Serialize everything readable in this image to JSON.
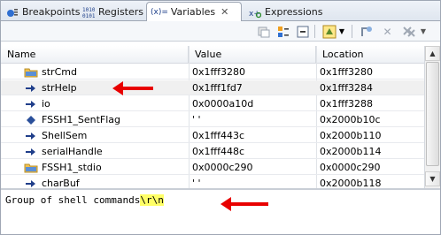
{
  "tabs": [
    {
      "label": "Breakpoints",
      "icon": "breakpoints-icon"
    },
    {
      "label": "Registers",
      "icon": "registers-icon"
    },
    {
      "label": "Variables",
      "icon": "variables-icon",
      "active": true
    },
    {
      "label": "Expressions",
      "icon": "expressions-icon"
    }
  ],
  "tab_prefix": {
    "variables": "(x)="
  },
  "table": {
    "columns": [
      "Name",
      "Value",
      "Location"
    ],
    "rows": [
      {
        "name": "strCmd",
        "value": "0x1fff3280",
        "location": "0x1fff3280",
        "icon": "struct-folder-icon"
      },
      {
        "name": "strHelp",
        "value": "0x1fff1fd7",
        "location": "0x1fff3284",
        "icon": "pointer-arrow-icon",
        "selected": true
      },
      {
        "name": "io",
        "value": "0x0000a10d",
        "location": "0x1fff3288",
        "icon": "pointer-arrow-icon"
      },
      {
        "name": "FSSH1_SentFlag",
        "value": "' '",
        "location": "0x2000b10c",
        "icon": "variable-diamond-icon"
      },
      {
        "name": "ShellSem",
        "value": "0x1fff443c",
        "location": "0x2000b110",
        "icon": "pointer-arrow-icon"
      },
      {
        "name": "serialHandle",
        "value": "0x1fff448c",
        "location": "0x2000b114",
        "icon": "pointer-arrow-icon"
      },
      {
        "name": "FSSH1_stdio",
        "value": "0x0000c290",
        "location": "0x0000c290",
        "icon": "struct-folder-icon"
      },
      {
        "name": "charBuf",
        "value": "' '",
        "location": "0x2000b118",
        "icon": "pointer-arrow-icon"
      }
    ]
  },
  "detail": {
    "text_main": "Group of shell commands",
    "text_highlight": "\\r\\n"
  },
  "colors": {
    "arrow": "#e80000",
    "highlight": "#ffff66",
    "selected_row": "#f0f0f0"
  }
}
